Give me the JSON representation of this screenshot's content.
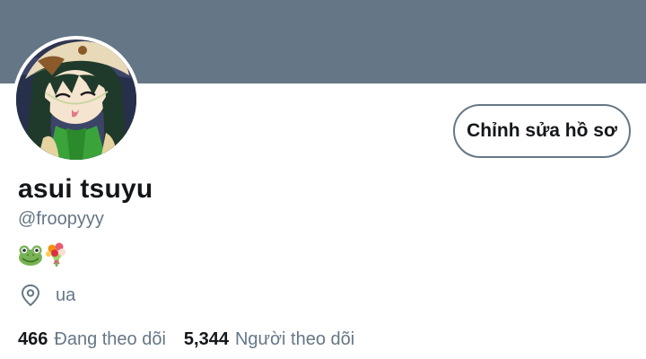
{
  "profile": {
    "display_name": "asui tsuyu",
    "handle": "@froopyyy",
    "bio_emojis": [
      "frog-face-emoji",
      "bouquet-emoji"
    ],
    "location": "ua",
    "edit_button_label": "Chỉnh sửa hồ sơ",
    "avatar_icon": "anime-character-avatar"
  },
  "stats": {
    "following_count": "466",
    "following_label": "Đang theo dõi",
    "followers_count": "5,344",
    "followers_label": "Người theo dõi"
  },
  "colors": {
    "banner": "#657786",
    "text_primary": "#14171a",
    "text_secondary": "#657786",
    "background": "#ffffff"
  }
}
